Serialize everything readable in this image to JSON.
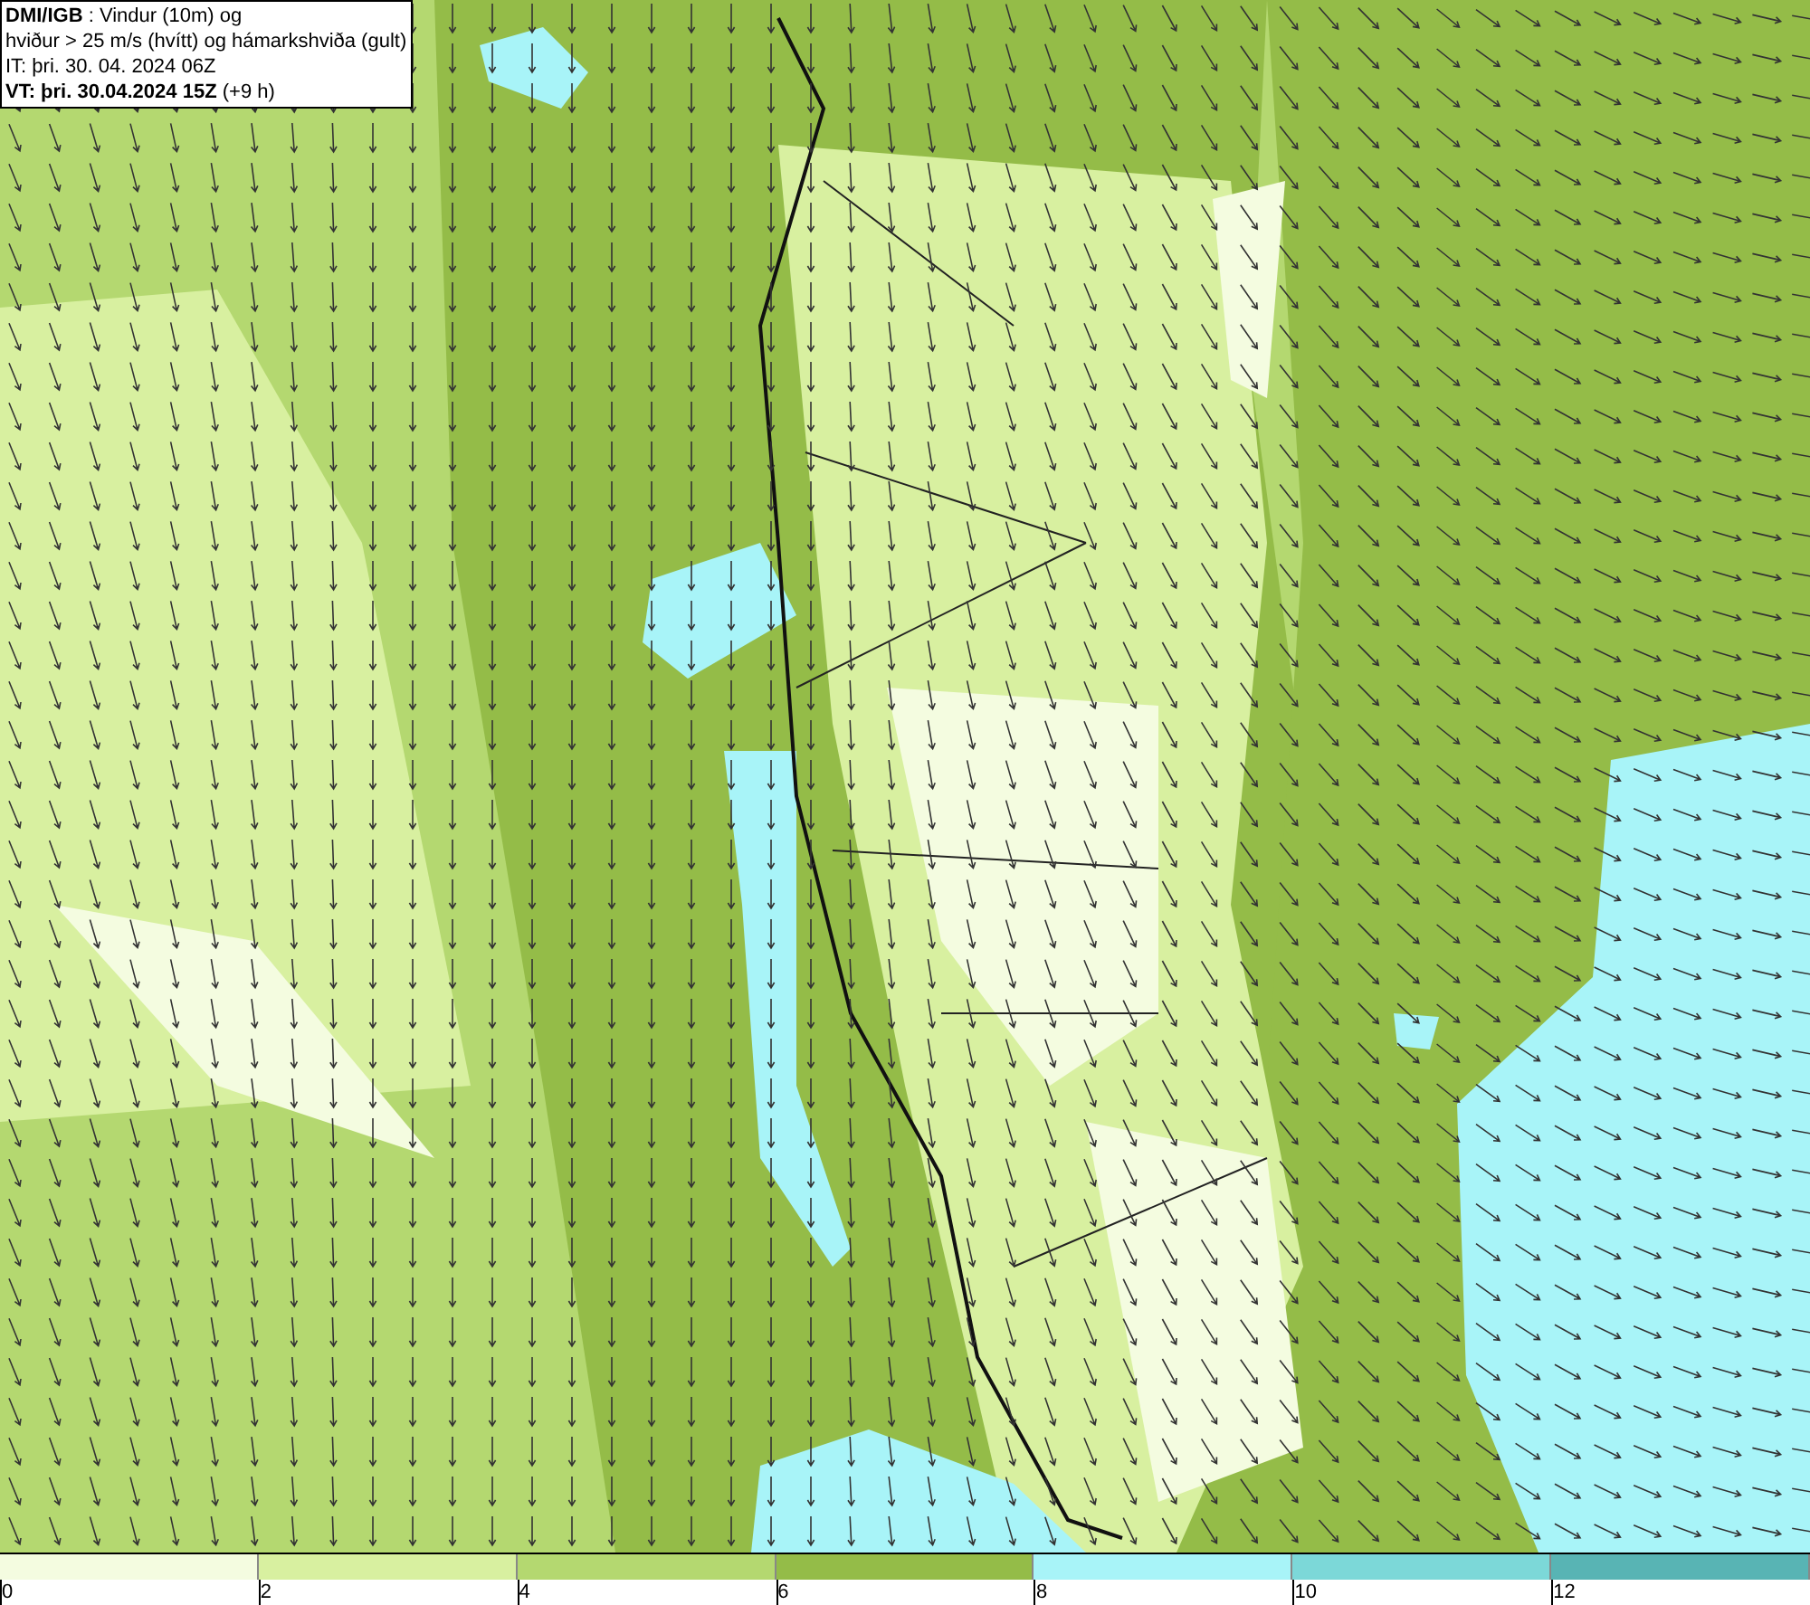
{
  "header": {
    "lines": [
      "**DMI/IGB** : Vindur (10m) og",
      "hviður > 25 m/s (hvítt) og hámarkshviða (gult)",
      "IT: þri. 30. 04. 2024 06Z",
      "**VT: þri. 30.04.2024 15Z** (+9 h)"
    ]
  },
  "legend": [
    {
      "color": "#f4fce0",
      "label": "0"
    },
    {
      "color": "#d8f0a0",
      "label": "2"
    },
    {
      "color": "#b4d870",
      "label": "4"
    },
    {
      "color": "#94bc48",
      "label": "6"
    },
    {
      "color": "#a8f4f8",
      "label": "8"
    },
    {
      "color": "#7cd8d8",
      "label": "10"
    },
    {
      "color": "#58b4b4",
      "label": "12"
    }
  ]
}
